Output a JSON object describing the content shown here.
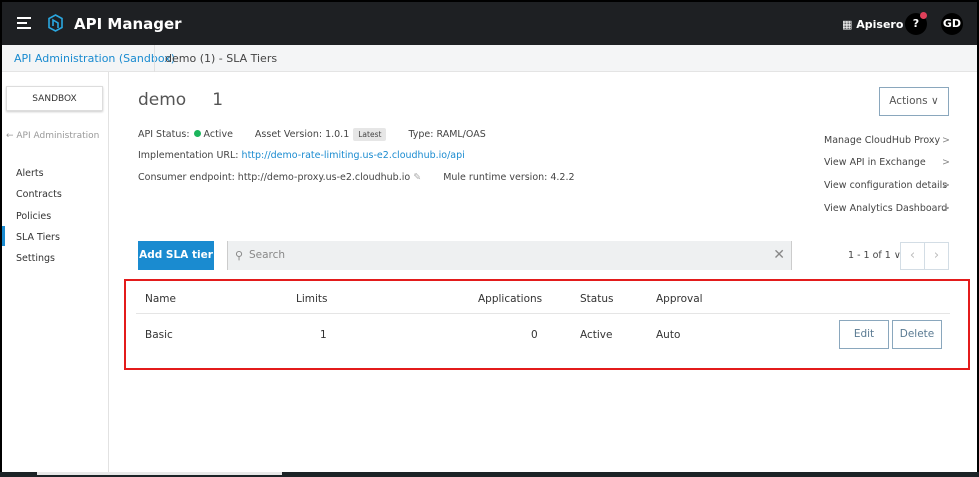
{
  "header": {
    "title": "API Manager",
    "org": "Apisero",
    "help": "?",
    "avatar": "GD"
  },
  "breadcrumb": {
    "parent": "API Administration (Sandbox)",
    "current": "demo (1) - SLA Tiers"
  },
  "sidebar": {
    "env": "SANDBOX",
    "back": "← API Administration",
    "items": [
      {
        "label": "Alerts"
      },
      {
        "label": "Contracts"
      },
      {
        "label": "Policies"
      },
      {
        "label": "SLA Tiers",
        "active": true
      },
      {
        "label": "Settings"
      }
    ]
  },
  "api": {
    "name": "demo",
    "version": "1",
    "status_label": "API Status:",
    "status": "Active",
    "asset_version": "Asset Version: 1.0.1",
    "latest": "Latest",
    "type": "Type: RAML/OAS",
    "impl_label": "Implementation URL:",
    "impl_url": "http://demo-rate-limiting.us-e2.cloudhub.io/api",
    "consumer": "Consumer endpoint: http://demo-proxy.us-e2.cloudhub.io",
    "runtime": "Mule runtime version: 4.2.2",
    "status_color": "#1bb55c"
  },
  "actions": {
    "label": "Actions ∨",
    "links": [
      "Manage CloudHub Proxy",
      "View API in Exchange",
      "View configuration details",
      "View Analytics Dashboard"
    ]
  },
  "toolbar": {
    "add": "Add SLA tier",
    "search_placeholder": "Search",
    "pagination": "1 - 1 of 1 ∨"
  },
  "table": {
    "headers": [
      "Name",
      "Limits",
      "Applications",
      "Status",
      "Approval"
    ],
    "rows": [
      {
        "name": "Basic",
        "limits": "1",
        "applications": "0",
        "status": "Active",
        "approval": "Auto",
        "edit": "Edit",
        "delete": "Delete"
      }
    ]
  }
}
